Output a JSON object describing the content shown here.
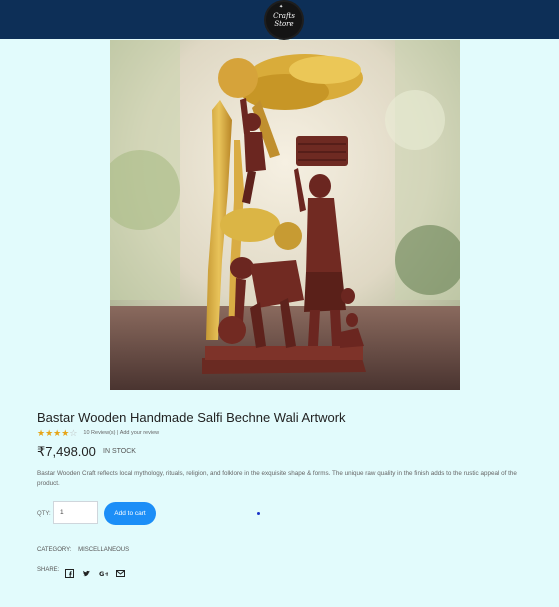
{
  "header": {
    "logo_line1": "Crafts",
    "logo_line2": "Store"
  },
  "product": {
    "title": "Bastar Wooden Handmade Salfi Bechne Wali Artwork",
    "rating": 4,
    "rating_max": 5,
    "reviews_text": "10 Review(s)",
    "review_separator": "|",
    "add_review_text": "Add your review",
    "price": "₹7,498.00",
    "stock": "IN STOCK",
    "description": "Bastar Wooden Craft reflects local mythology, rituals, religion, and folklore in the exquisite shape & forms. The unique raw quality in the finish adds to the rustic appeal of the product.",
    "qty_label": "QTY:",
    "qty_value": "1",
    "add_to_cart": "Add to cart",
    "category_label": "CATEGORY:",
    "category_value": "MISCELLANEOUS",
    "share_label": "SHARE:"
  },
  "share_icons": [
    "facebook-icon",
    "twitter-icon",
    "google-plus-icon",
    "email-icon"
  ],
  "colors": {
    "header_bg": "#0d2f57",
    "page_bg": "#e2fbfc",
    "accent": "#1c8ef7",
    "star": "#e6a417"
  }
}
